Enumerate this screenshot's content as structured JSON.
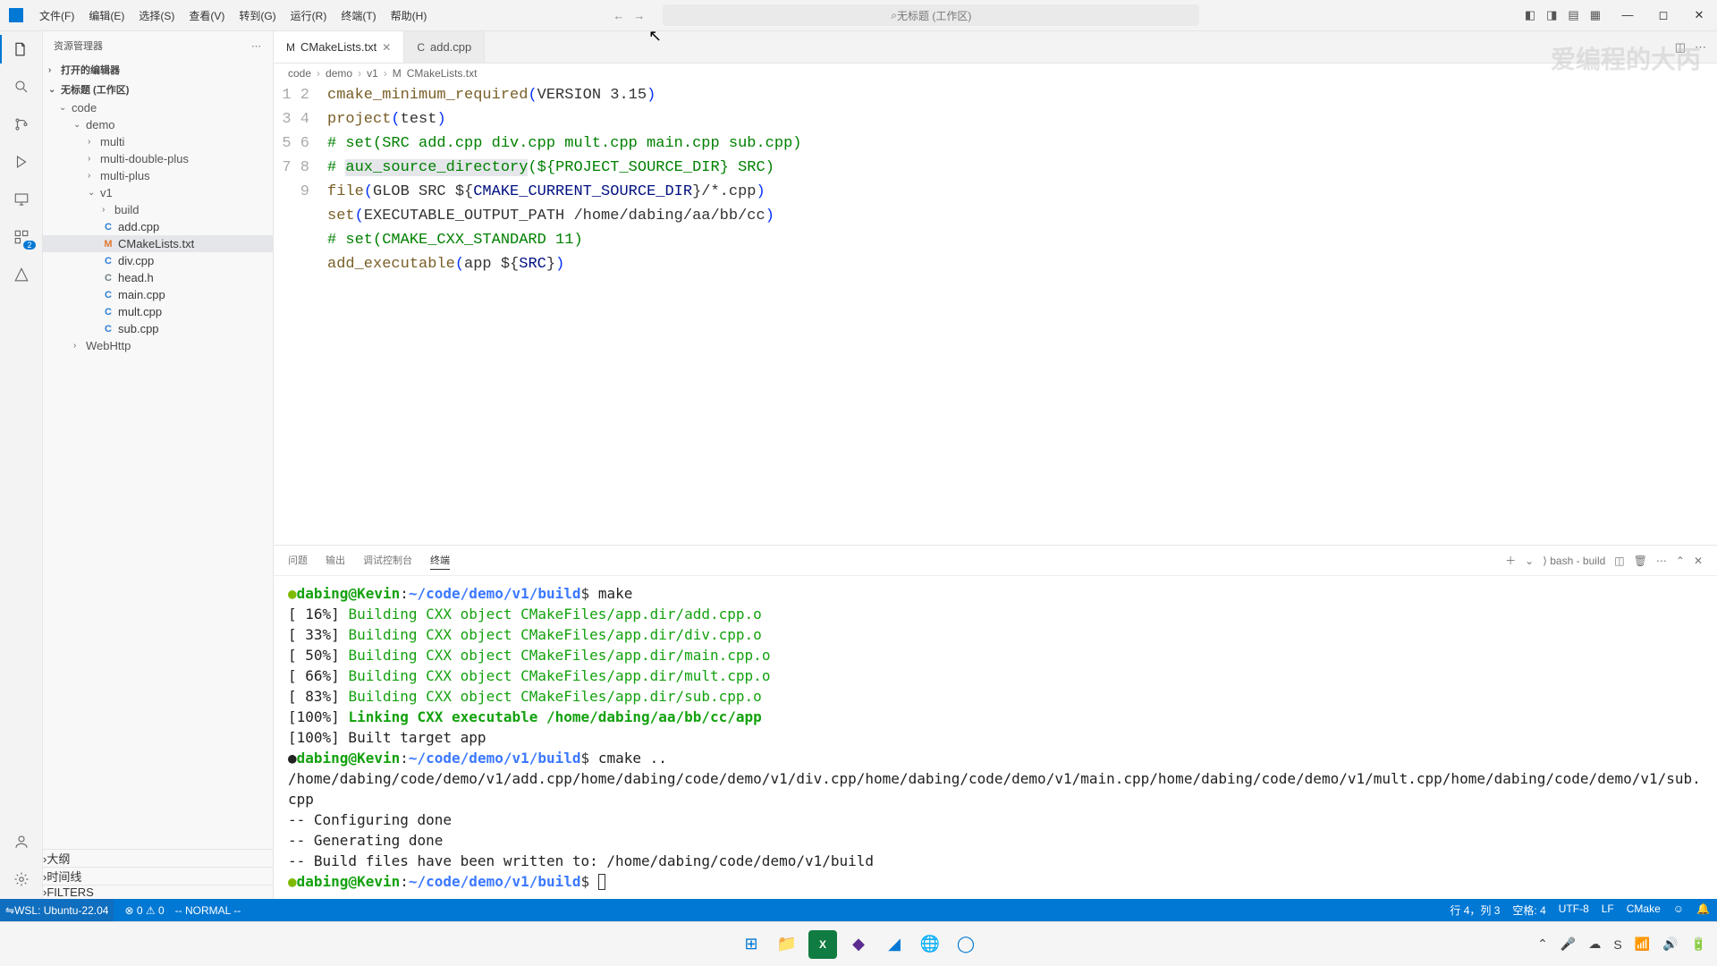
{
  "menu": {
    "file": "文件(F)",
    "edit": "编辑(E)",
    "select": "选择(S)",
    "view": "查看(V)",
    "goto": "转到(G)",
    "run": "运行(R)",
    "terminal": "终端(T)",
    "help": "帮助(H)"
  },
  "search_placeholder": "无标题 (工作区)",
  "sidebar": {
    "title": "资源管理器",
    "open_editors": "打开的编辑器",
    "workspace": "无标题 (工作区)",
    "folders": {
      "code": "code",
      "demo": "demo",
      "multi": "multi",
      "multi_double_plus": "multi-double-plus",
      "multi_plus": "multi-plus",
      "v1": "v1",
      "build": "build"
    },
    "files": {
      "add": "add.cpp",
      "cmake": "CMakeLists.txt",
      "div": "div.cpp",
      "head": "head.h",
      "main": "main.cpp",
      "mult": "mult.cpp",
      "sub": "sub.cpp"
    },
    "webhttp": "WebHttp",
    "outline": "大纲",
    "timeline": "时间线",
    "filters": "FILTERS"
  },
  "tabs": {
    "cmake": "CMakeLists.txt",
    "add": "add.cpp"
  },
  "breadcrumb": {
    "p1": "code",
    "p2": "demo",
    "p3": "v1",
    "p4": "CMakeLists.txt"
  },
  "code": {
    "l1_fn": "cmake_minimum_required",
    "l1_arg": "VERSION 3.15",
    "l2_fn": "project",
    "l2_arg": "test",
    "l3": "# set(SRC add.cpp div.cpp mult.cpp main.cpp sub.cpp)",
    "l4_pre": "# ",
    "l4_fn": "aux_source_directory",
    "l4_mid": "(${",
    "l4_var": "PROJECT_SOURCE_DIR",
    "l4_tail": "} SRC)",
    "l5_fn": "file",
    "l5_a": "GLOB SRC ${",
    "l5_var": "CMAKE_CURRENT_SOURCE_DIR",
    "l5_b": "}/*.cpp",
    "l6_fn": "set",
    "l6_a": "EXECUTABLE_OUTPUT_PATH /home/dabing/aa/bb/cc",
    "l7": "# set(CMAKE_CXX_STANDARD 11)",
    "l8_fn": "add_executable",
    "l8_a": "app ${",
    "l8_var": "SRC",
    "l8_b": "}"
  },
  "panel": {
    "problems": "问题",
    "output": "输出",
    "debug": "调试控制台",
    "terminal": "终端",
    "shell": "bash - build"
  },
  "terminal": {
    "prompt_user": "dabing@Kevin",
    "prompt_path": "~/code/demo/v1/build",
    "prompt_sym": "$",
    "cmd1": "make",
    "b1": "[ 16%] ",
    "b1t": "Building CXX object CMakeFiles/app.dir/add.cpp.o",
    "b2": "[ 33%] ",
    "b2t": "Building CXX object CMakeFiles/app.dir/div.cpp.o",
    "b3": "[ 50%] ",
    "b3t": "Building CXX object CMakeFiles/app.dir/main.cpp.o",
    "b4": "[ 66%] ",
    "b4t": "Building CXX object CMakeFiles/app.dir/mult.cpp.o",
    "b5": "[ 83%] ",
    "b5t": "Building CXX object CMakeFiles/app.dir/sub.cpp.o",
    "b6": "[100%] ",
    "b6t": "Linking CXX executable /home/dabing/aa/bb/cc/app",
    "b7": "[100%] Built target app",
    "cmd2": "cmake ..",
    "paths": "/home/dabing/code/demo/v1/add.cpp/home/dabing/code/demo/v1/div.cpp/home/dabing/code/demo/v1/main.cpp/home/dabing/code/demo/v1/mult.cpp/home/dabing/code/demo/v1/sub.cpp",
    "cfg": "-- Configuring done",
    "gen": "-- Generating done",
    "written": "-- Build files have been written to: /home/dabing/code/demo/v1/build"
  },
  "status": {
    "remote": "WSL: Ubuntu-22.04",
    "errors": "⊗ 0 ⚠ 0",
    "mode": "-- NORMAL --",
    "pos": "行 4，列 3",
    "spaces": "空格: 4",
    "enc": "UTF-8",
    "eol": "LF",
    "lang": "CMake"
  }
}
